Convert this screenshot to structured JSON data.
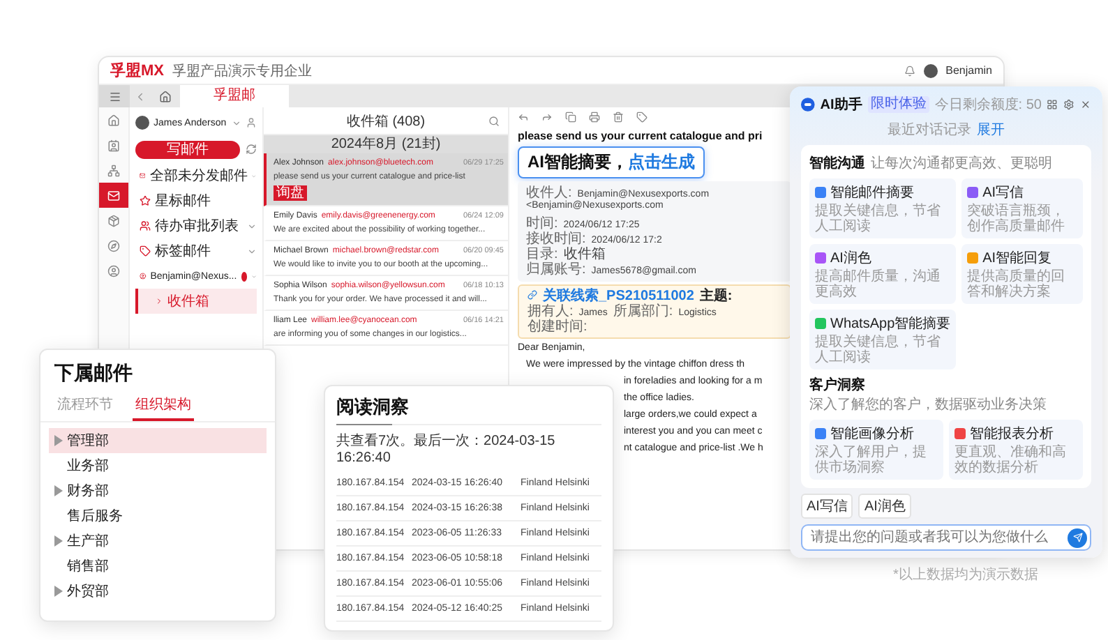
{
  "app": {
    "logo": "孚盟MX",
    "company": "孚盟产品演示专用企业",
    "user": "Benjamin"
  },
  "tabs": [
    {
      "label": "孚盟邮",
      "selected": true
    }
  ],
  "rail": [
    {
      "selected": false
    },
    {
      "selected": false
    },
    {
      "selected": false
    },
    {
      "selected": true
    },
    {
      "selected": false
    },
    {
      "selected": false
    },
    {
      "selected": false
    }
  ],
  "account": {
    "name": "James Anderson"
  },
  "compose": "写邮件",
  "folders": [
    {
      "label": "全部未分发邮件",
      "kind": "group",
      "selected": false
    },
    {
      "label": "星标邮件",
      "kind": "item",
      "selected": false
    },
    {
      "label": "待办审批列表",
      "kind": "group",
      "selected": false
    },
    {
      "label": "标签邮件",
      "kind": "group",
      "selected": false
    },
    {
      "label": "Benjamin@Nexus...",
      "kind": "account",
      "selected": false,
      "children": [
        {
          "label": "收件箱",
          "selected": true
        }
      ]
    }
  ],
  "list": {
    "title": "收件箱 (408)",
    "group": "2024年8月 (21封)",
    "rows": [
      {
        "name": "Alex Johnson",
        "email": "alex.johnson@bluetech.com",
        "time": "06/29 17:25",
        "preview": "please send us your current catalogue and price-list",
        "tag": "询盘",
        "selected": true
      },
      {
        "name": "Emily Davis",
        "email": "emily.davis@greenenergy.com",
        "time": "06/24 12:09",
        "preview": "We are excited about the possibility of working together...",
        "selected": false
      },
      {
        "name": "Michael Brown",
        "email": "michael.brown@redstar.com",
        "time": "06/20 09:45",
        "preview": "We would like to invite you to our booth at the upcoming...",
        "selected": false
      },
      {
        "name": "Sophia Wilson",
        "email": "sophia.wilson@yellowsun.com",
        "time": "06/18 10:13",
        "preview": "Thank you for your order. We have processed it and will...",
        "selected": false
      },
      {
        "name": "lliam Lee",
        "email": "william.lee@cyanocean.com",
        "time": "06/16 14:21",
        "preview": "are informing you of some changes in our logistics...",
        "selected": false
      }
    ]
  },
  "reader": {
    "subject": "please send us your current catalogue and pri",
    "callout": {
      "text": "AI智能摘要，",
      "link": "点击生成"
    },
    "meta": [
      {
        "label": "收件人:",
        "value": "Benjamin@Nexusexports.com"
      },
      {
        "value": "<Benjamin@Nexusexports.com"
      },
      {
        "label": "时间:",
        "value": "2024/06/12 17:25"
      },
      {
        "label": "接收时间:",
        "value": "2024/06/12 17:2"
      },
      {
        "label": "目录:",
        "value": "收件箱"
      },
      {
        "label": "归属账号:",
        "value": "James5678@gmail.com"
      }
    ],
    "lead": {
      "link": "关联线索_PS210511002",
      "subject_label": "主题:",
      "fields": [
        {
          "label": "拥有人:",
          "value": "James"
        },
        {
          "label": "所属部门:",
          "value": "Logistics"
        },
        {
          "label": "创建时间:"
        }
      ]
    },
    "greeting": "Dear Benjamin,",
    "first_line": "We were impressed by the vintage chiffon dress th",
    "fragments": [
      "in foreladies and looking for a m",
      "the office ladies.",
      "large orders,we could expect a",
      "interest you and you can meet c",
      "nt catalogue and price-list .We h"
    ]
  },
  "subordinate_card": {
    "title": "下属邮件",
    "tabs": [
      {
        "label": "流程环节",
        "selected": false
      },
      {
        "label": "组织架构",
        "selected": true
      }
    ],
    "tree": [
      {
        "label": "管理部",
        "kind": "branch",
        "selected": true
      },
      {
        "label": "业务部",
        "kind": "leaf",
        "selected": false
      },
      {
        "label": "财务部",
        "kind": "branch",
        "selected": false
      },
      {
        "label": "售后服务",
        "kind": "leaf",
        "selected": false
      },
      {
        "label": "生产部",
        "kind": "branch",
        "selected": false
      },
      {
        "label": "销售部",
        "kind": "leaf",
        "selected": false
      },
      {
        "label": "外贸部",
        "kind": "branch",
        "selected": false
      }
    ]
  },
  "read_insight": {
    "title": "阅读洞察",
    "summary": "共查看7次。最后一次：2024-03-15 16:26:40",
    "rows": [
      {
        "ip": "180.167.84.154",
        "time": "2024-03-15 16:26:40",
        "location": "Finland Helsinki"
      },
      {
        "ip": "180.167.84.154",
        "time": "2024-03-15 16:26:38",
        "location": "Finland Helsinki"
      },
      {
        "ip": "180.167.84.154",
        "time": "2023-06-05 11:26:33",
        "location": "Finland Helsinki"
      },
      {
        "ip": "180.167.84.154",
        "time": "2023-06-05 10:58:18",
        "location": "Finland Helsinki"
      },
      {
        "ip": "180.167.84.154",
        "time": "2023-06-01 10:55:06",
        "location": "Finland Helsinki"
      },
      {
        "ip": "180.167.84.154",
        "time": "2024-05-12 16:40:25",
        "location": "Finland Helsinki"
      }
    ]
  },
  "ai_panel": {
    "title": "AI助手",
    "badge": "限时体验",
    "quota": "今日剩余额度: 50",
    "history": "最近对话记录",
    "expand": "展开",
    "sections": [
      {
        "title": "智能沟通",
        "subtitle": "让每次沟通都更高效、更聪明",
        "items": [
          {
            "title": "智能邮件摘要",
            "desc": "提取关键信息，节省人工阅读"
          },
          {
            "title": "AI写信",
            "desc": "突破语言瓶颈，创作高质量邮件"
          },
          {
            "title": "AI润色",
            "desc": "提高邮件质量，沟通更高效"
          },
          {
            "title": "AI智能回复",
            "desc": "提供高质量的回答和解决方案"
          },
          {
            "title": "WhatsApp智能摘要",
            "desc": "提取关键信息，节省人工阅读"
          }
        ]
      },
      {
        "title": "客户洞察",
        "subtitle": "深入了解您的客户，数据驱动业务决策",
        "items": [
          {
            "title": "智能画像分析",
            "desc": "深入了解用户，提供市场洞察"
          },
          {
            "title": "智能报表分析",
            "desc": "更直观、准确和高效的数据分析"
          }
        ]
      }
    ],
    "chips": [
      "AI写信",
      "AI润色"
    ],
    "placeholder": "请提出您的问题或者我可以为您做什么"
  },
  "footnote": "*以上数据均为演示数据"
}
